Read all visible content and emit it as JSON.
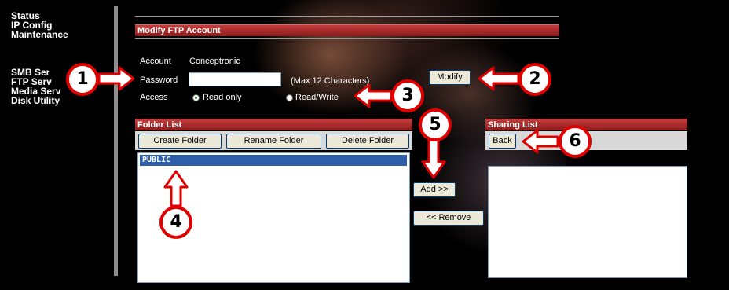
{
  "sidebar": {
    "items": [
      "Status",
      "IP Config",
      "Maintenance"
    ],
    "items2": [
      "SMB Ser",
      "FTP Serv",
      "Media Serv",
      "Disk Utility"
    ]
  },
  "modify_section": {
    "title": "Modify FTP Account",
    "account_label": "Account",
    "account_value": "Conceptronic",
    "password_label": "Password",
    "password_value": "",
    "password_hint": "(Max 12 Characters)",
    "access_label": "Access",
    "access_options": [
      "Read only",
      "Read/Write"
    ],
    "access_selected": "Read only",
    "modify_button": "Modify"
  },
  "folder_list": {
    "title": "Folder List",
    "buttons": [
      "Create Folder",
      "Rename Folder",
      "Delete Folder"
    ],
    "items": [
      "PUBLIC"
    ],
    "selected": "PUBLIC"
  },
  "transfer": {
    "add_button": "Add >>",
    "remove_button": "<< Remove"
  },
  "sharing_list": {
    "title": "Sharing List",
    "back_button": "Back",
    "items": []
  },
  "annotations": [
    "1",
    "2",
    "3",
    "4",
    "5",
    "6"
  ],
  "colors": {
    "accent_bar": "#b22a2a",
    "selection": "#2f5ea8",
    "annotation": "#e00000"
  }
}
